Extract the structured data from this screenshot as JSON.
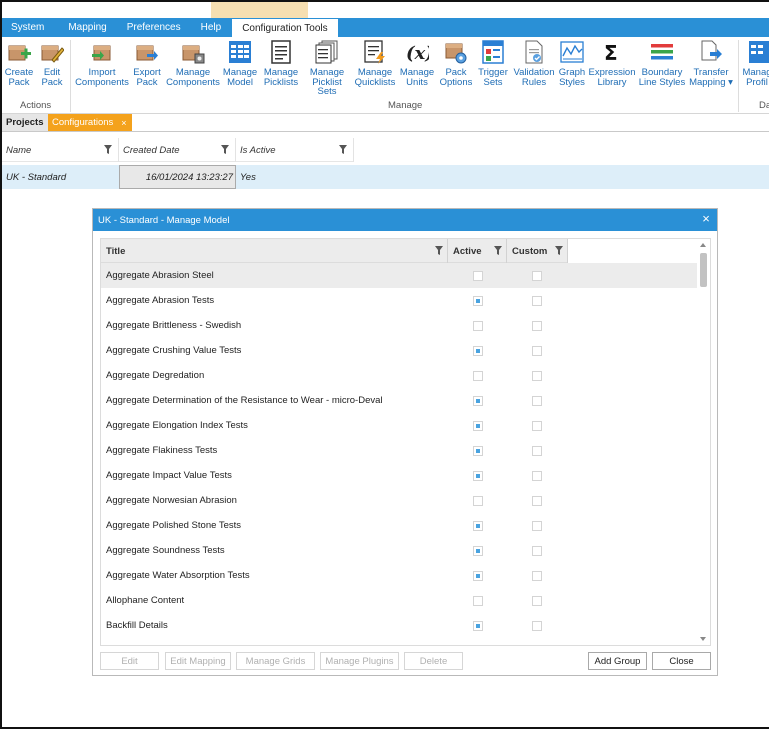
{
  "ribbon_tabs": [
    "System",
    "Mapping",
    "Preferences",
    "Help",
    "Configuration Tools"
  ],
  "active_ribbon_tab": "Configuration Tools",
  "ribbon": {
    "actions_group": "Actions",
    "manage_group": "Manage",
    "cut_group_label": "Da",
    "buttons": {
      "create_pack": [
        "Create",
        "Pack"
      ],
      "edit_pack": [
        "Edit",
        "Pack"
      ],
      "import_components": [
        "Import",
        "Components"
      ],
      "export_pack": [
        "Export",
        "Pack"
      ],
      "manage_components": [
        "Manage",
        "Components"
      ],
      "manage_model": [
        "Manage",
        "Model"
      ],
      "manage_picklists": [
        "Manage",
        "Picklists"
      ],
      "manage_picklist_sets": [
        "Manage",
        "Picklist Sets"
      ],
      "manage_quicklists": [
        "Manage",
        "Quicklists"
      ],
      "manage_units": [
        "Manage",
        "Units"
      ],
      "pack_options": [
        "Pack",
        "Options"
      ],
      "trigger_sets": [
        "Trigger",
        "Sets"
      ],
      "validation_rules": [
        "Validation",
        "Rules"
      ],
      "graph_styles": [
        "Graph",
        "Styles"
      ],
      "expression_library": [
        "Expression",
        "Library"
      ],
      "boundary_line_styles": [
        "Boundary",
        "Line Styles"
      ],
      "transfer_mapping": [
        "Transfer",
        "Mapping ▾"
      ],
      "manage_profiles": [
        "Manag",
        "Profil"
      ]
    }
  },
  "doc_tabs": {
    "projects": "Projects",
    "configurations": "Configurations",
    "close_glyph": "×"
  },
  "config_grid": {
    "columns": [
      "Name",
      "Created Date",
      "Is Active"
    ],
    "rows": [
      {
        "name": "UK - Standard",
        "created": "16/01/2024 13:23:27",
        "active": "Yes"
      }
    ]
  },
  "dialog": {
    "title": "UK - Standard - Manage Model",
    "close_glyph": "×",
    "columns": {
      "title": "Title",
      "active": "Active",
      "custom": "Custom"
    },
    "rows": [
      {
        "title": "Aggregate Abrasion Steel",
        "active": false,
        "custom": false
      },
      {
        "title": "Aggregate Abrasion Tests",
        "active": true,
        "custom": false
      },
      {
        "title": "Aggregate Brittleness - Swedish",
        "active": false,
        "custom": false
      },
      {
        "title": "Aggregate Crushing Value Tests",
        "active": true,
        "custom": false
      },
      {
        "title": "Aggregate Degredation",
        "active": false,
        "custom": false
      },
      {
        "title": "Aggregate Determination of the Resistance to Wear - micro-Deval",
        "active": true,
        "custom": false
      },
      {
        "title": "Aggregate Elongation Index Tests",
        "active": true,
        "custom": false
      },
      {
        "title": "Aggregate Flakiness Tests",
        "active": true,
        "custom": false
      },
      {
        "title": "Aggregate Impact Value Tests",
        "active": true,
        "custom": false
      },
      {
        "title": "Aggregate Norwesian Abrasion",
        "active": false,
        "custom": false
      },
      {
        "title": "Aggregate Polished Stone Tests",
        "active": true,
        "custom": false
      },
      {
        "title": "Aggregate Soundness Tests",
        "active": true,
        "custom": false
      },
      {
        "title": "Aggregate Water Absorption Tests",
        "active": true,
        "custom": false
      },
      {
        "title": "Allophane Content",
        "active": false,
        "custom": false
      },
      {
        "title": "Backfill Details",
        "active": true,
        "custom": false
      }
    ],
    "buttons": {
      "edit": "Edit",
      "edit_mapping": "Edit Mapping",
      "manage_grids": "Manage Grids",
      "manage_plugins": "Manage Plugins",
      "delete": "Delete",
      "add_group": "Add Group",
      "close": "Close"
    }
  },
  "colors": {
    "accent": "#2a90d6",
    "active_tab": "#f4a21c",
    "selected_row": "#ddeef9",
    "check": "#4aa3e0"
  }
}
